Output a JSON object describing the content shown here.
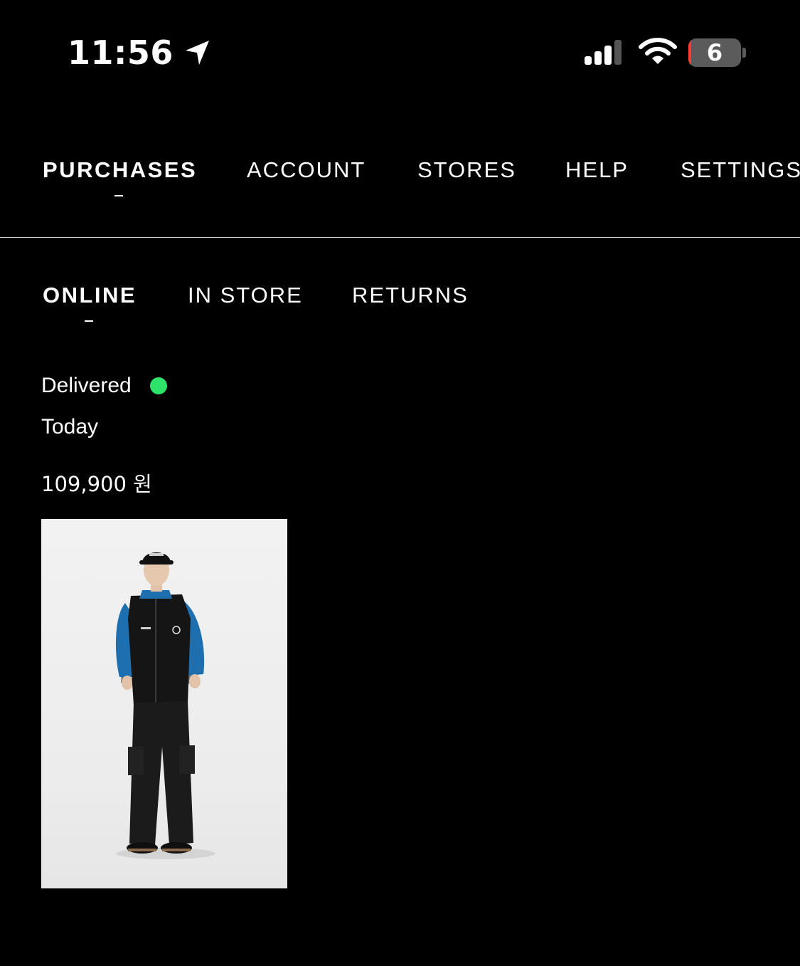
{
  "status_bar": {
    "time": "11:56",
    "battery_level": "6",
    "location_icon": "location-arrow-icon",
    "signal_icon": "cellular-signal-icon",
    "wifi_icon": "wifi-icon",
    "battery_icon": "battery-icon",
    "battery_color": "#ff3b30"
  },
  "main_tabs": [
    {
      "label": "PURCHASES",
      "active": true
    },
    {
      "label": "ACCOUNT",
      "active": false
    },
    {
      "label": "STORES",
      "active": false
    },
    {
      "label": "HELP",
      "active": false
    },
    {
      "label": "SETTINGS",
      "active": false
    }
  ],
  "sub_tabs": [
    {
      "label": "ONLINE",
      "active": true
    },
    {
      "label": "IN STORE",
      "active": false
    },
    {
      "label": "RETURNS",
      "active": false
    }
  ],
  "order": {
    "status": "Delivered",
    "status_color": "#2ee36a",
    "date": "Today",
    "price": "109,900 원",
    "product_image": "model-wearing-black-vest-blue-jacket-cargo-pants"
  },
  "colors": {
    "background": "#000000",
    "text": "#ffffff"
  }
}
